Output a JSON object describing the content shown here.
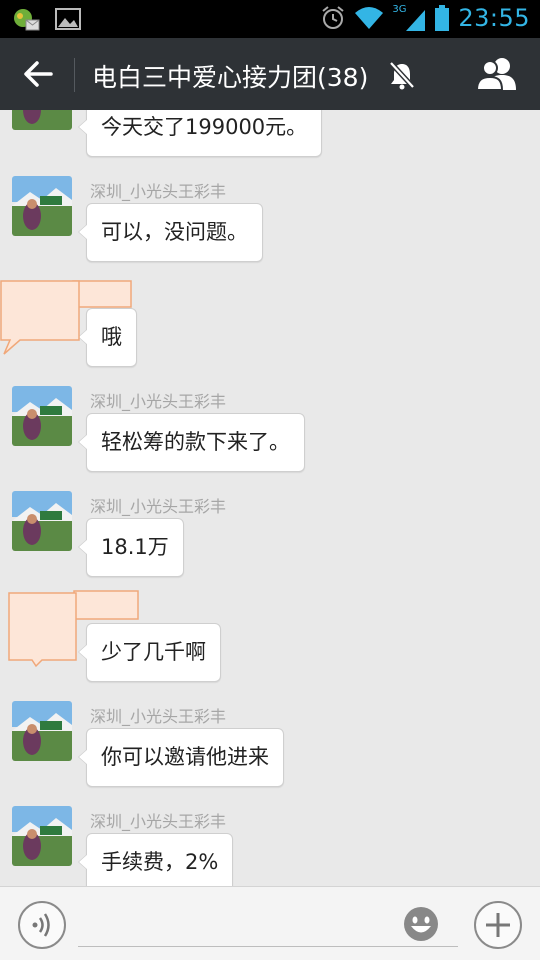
{
  "status_bar": {
    "time": "23:55",
    "network_label": "3G"
  },
  "header": {
    "title": "电白三中爱心接力团(38)"
  },
  "messages": [
    {
      "sender": "",
      "text": "今天交了199000元。"
    },
    {
      "sender": "深圳_小光头王彩丰",
      "text": "可以，没问题。"
    },
    {
      "sender": "",
      "text": "哦"
    },
    {
      "sender": "深圳_小光头王彩丰",
      "text": "轻松筹的款下来了。"
    },
    {
      "sender": "深圳_小光头王彩丰",
      "text": "18.1万"
    },
    {
      "sender": "",
      "text": "少了几千啊"
    },
    {
      "sender": "深圳_小光头王彩丰",
      "text": "你可以邀请他进来"
    },
    {
      "sender": "深圳_小光头王彩丰",
      "text": "手续费，2%"
    }
  ],
  "input": {
    "placeholder": ""
  },
  "icons": {
    "back": "arrow-left-icon",
    "mute": "bell-off-icon",
    "members": "people-icon",
    "voice": "voice-icon",
    "emoji": "smiley-icon",
    "plus": "plus-icon"
  },
  "colors": {
    "accent": "#33b5e5",
    "titlebar": "#2e3236",
    "chat_bg": "#e9e9e9",
    "overlay_fill": "#fde6d8",
    "overlay_stroke": "#f0a87a"
  }
}
